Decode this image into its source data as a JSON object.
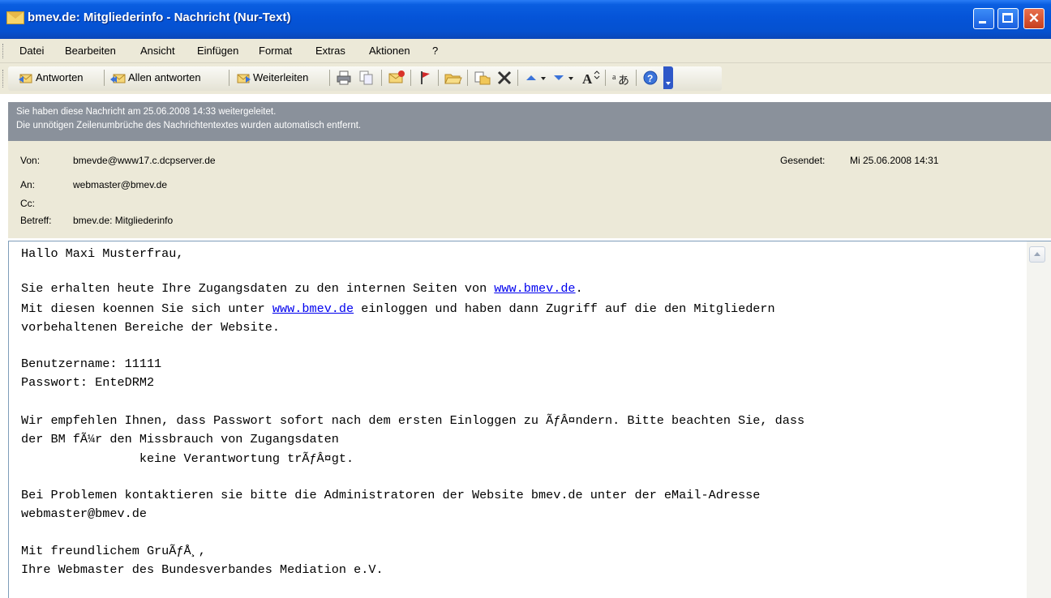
{
  "window": {
    "title": "bmev.de: Mitgliederinfo - Nachricht (Nur-Text)",
    "title_color": "#0a5ee0",
    "close_color": "#d9542f"
  },
  "menu": [
    "Datei",
    "Bearbeiten",
    "Ansicht",
    "Einfügen",
    "Format",
    "Extras",
    "Aktionen",
    "?"
  ],
  "toolbar": {
    "reply": "Antworten",
    "reply_all": "Allen antworten",
    "forward": "Weiterleiten",
    "icons": [
      "reply-icon",
      "reply-all-icon",
      "forward-icon",
      "print-icon",
      "copy-icon",
      "mark-unread-icon",
      "flag-icon",
      "open-folder-icon",
      "move-icon",
      "delete-icon",
      "previous-item-icon",
      "next-item-icon",
      "text-size-icon",
      "encoding-icon",
      "help-icon"
    ]
  },
  "infobar": {
    "line1": "Sie haben diese Nachricht am 25.06.2008 14:33 weitergeleitet.",
    "line2": "Die unnötigen Zeilenumbrüche des Nachrichtentextes wurden automatisch entfernt."
  },
  "header": {
    "from_label": "Von:",
    "from": "bmevde@www17.c.dcpserver.de",
    "to_label": "An:",
    "to": "webmaster@bmev.de",
    "cc_label": "Cc:",
    "subject_label": "Betreff:",
    "subject": "bmev.de: Mitgliederinfo",
    "sent_label": "Gesendet:",
    "sent": "Mi 25.06.2008 14:31"
  },
  "body": {
    "greeting": "Hallo Maxi Musterfrau,",
    "p1_pre": "Sie erhalten heute Ihre Zugangsdaten zu den internen Seiten von ",
    "p1_link": "www.bmev.de",
    "p1_post": ".",
    "p2_pre": "Mit diesen koennen Sie sich unter ",
    "p2_link": "www.bmev.de",
    "p2_post": " einloggen und haben dann Zugriff auf die den Mitgliedern",
    "p2_line2": "vorbehaltenen Bereiche der Website.",
    "username": "Benutzername: 11111",
    "password": "Passwort: EnteDRM2",
    "p3_line1": "Wir empfehlen Ihnen, dass Passwort sofort nach dem ersten Einloggen zu ÃƒÂ¤ndern. Bitte beachten Sie, dass",
    "p3_line2": "der BM fÃ¼r den Missbrauch von Zugangsdaten",
    "p3_line3": "                keine Verantwortung trÃƒÂ¤gt.",
    "p4_line1": "Bei Problemen kontaktieren sie bitte die Administratoren der Website bmev.de unter der eMail-Adresse",
    "p4_line2": "webmaster@bmev.de",
    "closing": "Mit freundlichem GruÃƒÅ¸,",
    "signature": "Ihre Webmaster des Bundesverbandes Mediation e.V."
  }
}
